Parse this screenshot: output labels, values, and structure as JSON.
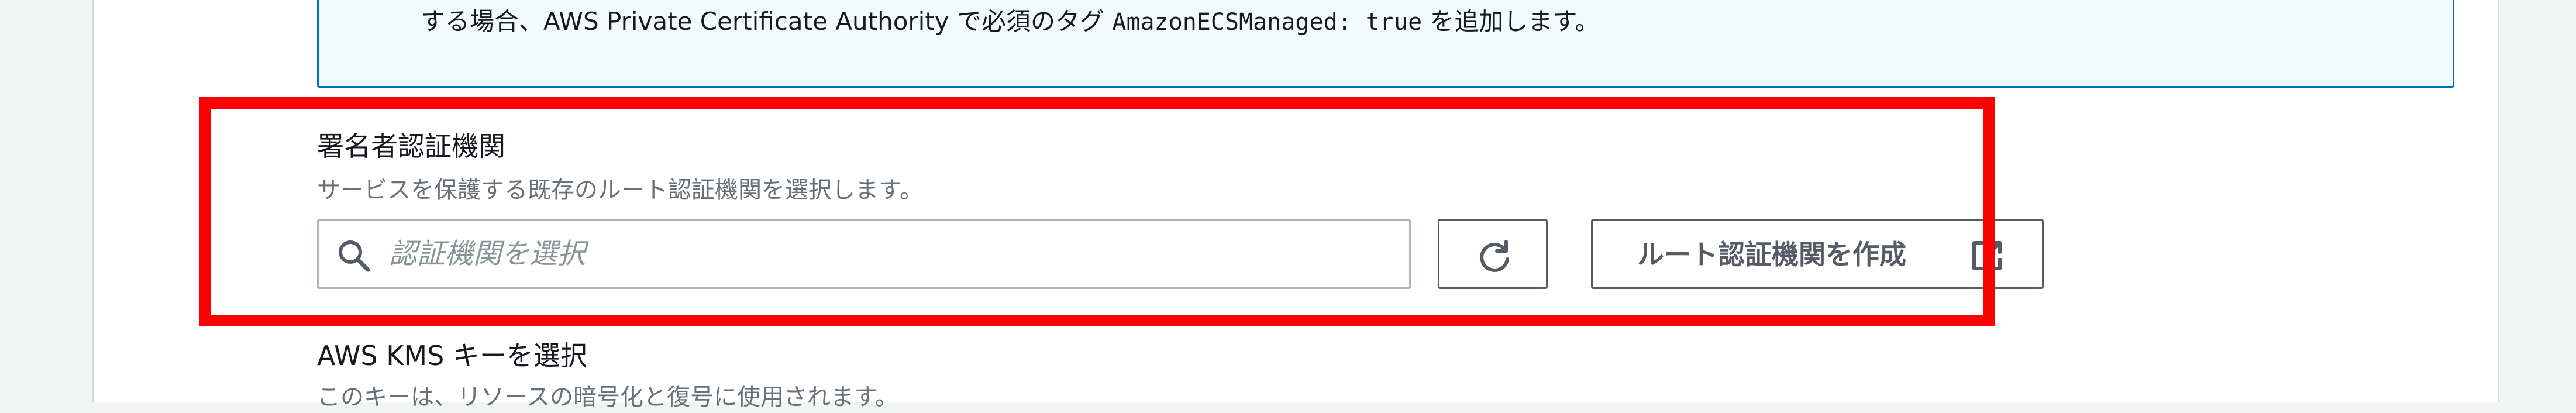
{
  "info": {
    "text_before": "する場合、AWS Private Certificate Authority で必須のタグ ",
    "code": "AmazonECSManaged: true",
    "text_after": " を追加します。"
  },
  "signing_ca": {
    "label": "署名者認証機関",
    "description": "サービスを保護する既存のルート認証機関を選択します。",
    "search_placeholder": "認証機関を選択",
    "search_value": "",
    "create_button_label": "ルート認証機関を作成"
  },
  "kms": {
    "label": "AWS KMS キーを選択",
    "description": "このキーは、リソースの暗号化と復号に使用されます。"
  },
  "icons": {
    "search": "search-icon",
    "refresh": "refresh-icon",
    "external_link": "external-link-icon"
  },
  "colors": {
    "highlight": "#ff0000",
    "info_border": "#0073bb",
    "info_background": "#f1faff"
  }
}
